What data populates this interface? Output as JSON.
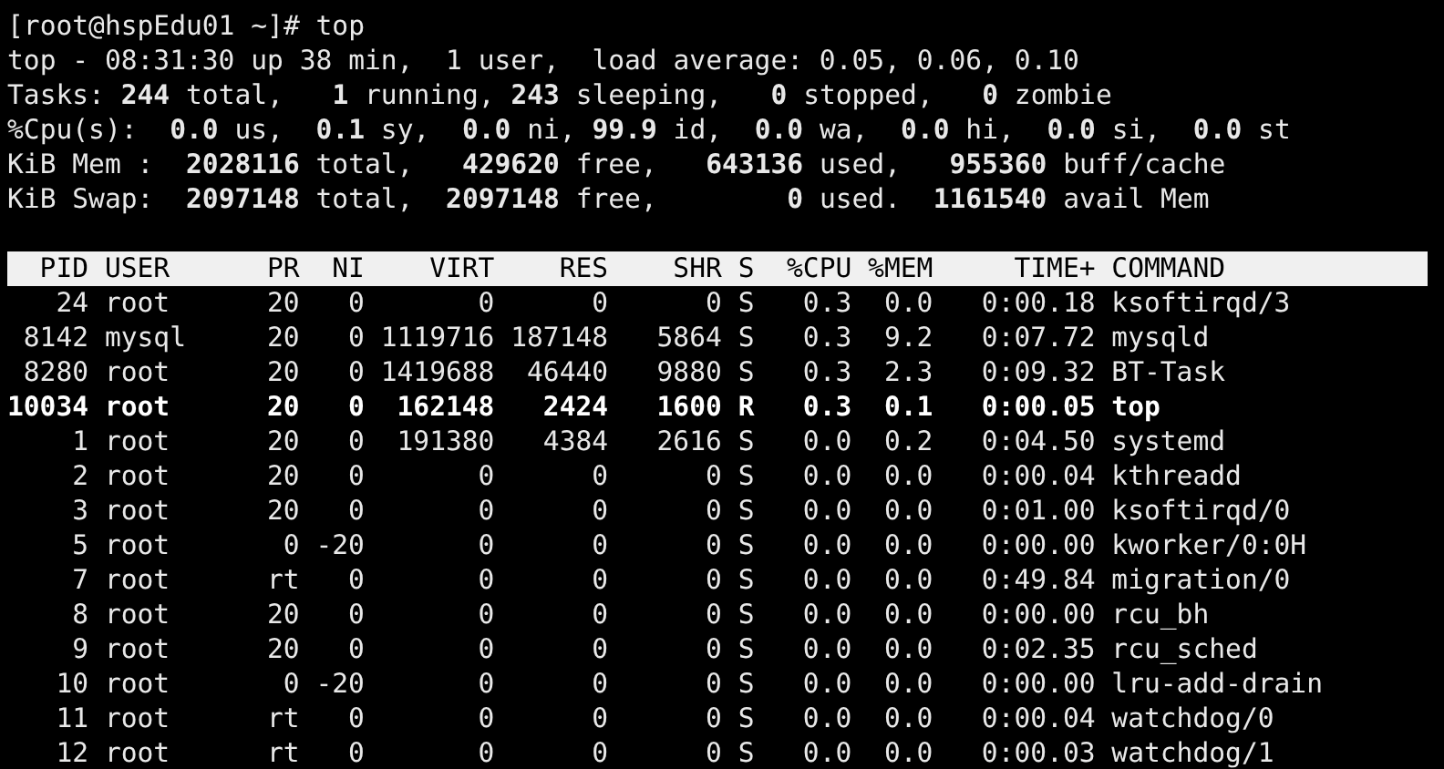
{
  "prompt": "[root@hspEdu01 ~]# top",
  "summary": [
    "top - 08:31:30 up 38 min,  1 user,  load average: 0.05, 0.06, 0.10",
    "Tasks: **244** total,   **1** running, **243** sleeping,   **0** stopped,   **0** zombie",
    "%Cpu(s):  **0.0** us,  **0.1** sy,  **0.0** ni, **99.9** id,  **0.0** wa,  **0.0** hi,  **0.0** si,  **0.0** st",
    "KiB Mem :  **2028116** total,   **429620** free,   **643136** used,   **955360** buff/cache",
    "KiB Swap:  **2097148** total,  **2097148** free,        **0** used.  **1161540** avail Mem"
  ],
  "table": {
    "columns": [
      "PID",
      "USER",
      "PR",
      "NI",
      "VIRT",
      "RES",
      "SHR",
      "S",
      "%CPU",
      "%MEM",
      "TIME+",
      "COMMAND"
    ],
    "rows": [
      {
        "running": false,
        "cells": [
          "24",
          "root",
          "20",
          "0",
          "0",
          "0",
          "0",
          "S",
          "0.3",
          "0.0",
          "0:00.18",
          "ksoftirqd/3"
        ]
      },
      {
        "running": false,
        "cells": [
          "8142",
          "mysql",
          "20",
          "0",
          "1119716",
          "187148",
          "5864",
          "S",
          "0.3",
          "9.2",
          "0:07.72",
          "mysqld"
        ]
      },
      {
        "running": false,
        "cells": [
          "8280",
          "root",
          "20",
          "0",
          "1419688",
          "46440",
          "9880",
          "S",
          "0.3",
          "2.3",
          "0:09.32",
          "BT-Task"
        ]
      },
      {
        "running": true,
        "cells": [
          "10034",
          "root",
          "20",
          "0",
          "162148",
          "2424",
          "1600",
          "R",
          "0.3",
          "0.1",
          "0:00.05",
          "top"
        ]
      },
      {
        "running": false,
        "cells": [
          "1",
          "root",
          "20",
          "0",
          "191380",
          "4384",
          "2616",
          "S",
          "0.0",
          "0.2",
          "0:04.50",
          "systemd"
        ]
      },
      {
        "running": false,
        "cells": [
          "2",
          "root",
          "20",
          "0",
          "0",
          "0",
          "0",
          "S",
          "0.0",
          "0.0",
          "0:00.04",
          "kthreadd"
        ]
      },
      {
        "running": false,
        "cells": [
          "3",
          "root",
          "20",
          "0",
          "0",
          "0",
          "0",
          "S",
          "0.0",
          "0.0",
          "0:01.00",
          "ksoftirqd/0"
        ]
      },
      {
        "running": false,
        "cells": [
          "5",
          "root",
          "0",
          "-20",
          "0",
          "0",
          "0",
          "S",
          "0.0",
          "0.0",
          "0:00.00",
          "kworker/0:0H"
        ]
      },
      {
        "running": false,
        "cells": [
          "7",
          "root",
          "rt",
          "0",
          "0",
          "0",
          "0",
          "S",
          "0.0",
          "0.0",
          "0:49.84",
          "migration/0"
        ]
      },
      {
        "running": false,
        "cells": [
          "8",
          "root",
          "20",
          "0",
          "0",
          "0",
          "0",
          "S",
          "0.0",
          "0.0",
          "0:00.00",
          "rcu_bh"
        ]
      },
      {
        "running": false,
        "cells": [
          "9",
          "root",
          "20",
          "0",
          "0",
          "0",
          "0",
          "S",
          "0.0",
          "0.0",
          "0:02.35",
          "rcu_sched"
        ]
      },
      {
        "running": false,
        "cells": [
          "10",
          "root",
          "0",
          "-20",
          "0",
          "0",
          "0",
          "S",
          "0.0",
          "0.0",
          "0:00.00",
          "lru-add-drain"
        ]
      },
      {
        "running": false,
        "cells": [
          "11",
          "root",
          "rt",
          "0",
          "0",
          "0",
          "0",
          "S",
          "0.0",
          "0.0",
          "0:00.04",
          "watchdog/0"
        ]
      },
      {
        "running": false,
        "cells": [
          "12",
          "root",
          "rt",
          "0",
          "0",
          "0",
          "0",
          "S",
          "0.0",
          "0.0",
          "0:00.03",
          "watchdog/1"
        ]
      }
    ]
  }
}
